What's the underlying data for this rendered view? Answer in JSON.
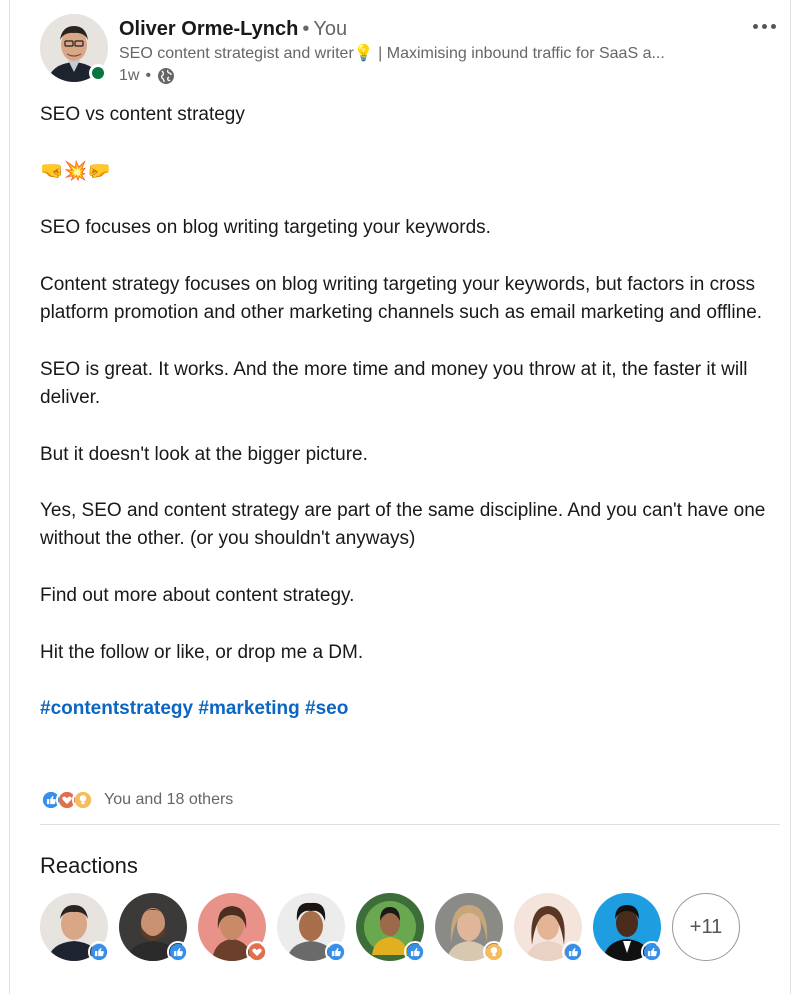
{
  "author": {
    "name": "Oliver Orme-Lynch",
    "separator": "•",
    "relation": "You",
    "headline": "SEO content strategist and writer💡 | Maximising inbound traffic for SaaS a...",
    "time": "1w",
    "meta_sep": "•",
    "visibility_icon": "globe-icon"
  },
  "post": {
    "lines": [
      "SEO vs content strategy",
      "SEO focuses on blog writing targeting your keywords.",
      "Content strategy focuses on blog writing targeting your keywords, but factors in cross platform promotion and other marketing channels such as email marketing and offline.",
      "SEO is great. It works. And the more time and money you throw at it, the faster it will deliver.",
      "But it doesn't look at the bigger picture.",
      "Yes, SEO and content strategy are part of the same discipline. And you can't have one without the other. (or you shouldn't anyways)",
      "Find out more about content strategy.",
      "Hit the follow or like, or drop me a DM."
    ],
    "emoji": "🤜💥🤛",
    "hashtags": [
      "#contentstrategy",
      "#marketing",
      "#seo"
    ]
  },
  "reactions_summary": {
    "icons": [
      "like-icon",
      "love-icon",
      "insightful-icon"
    ],
    "text": "You and 18 others"
  },
  "reactions_section": {
    "title": "Reactions",
    "reactors": [
      {
        "reaction": "like"
      },
      {
        "reaction": "like"
      },
      {
        "reaction": "love"
      },
      {
        "reaction": "like"
      },
      {
        "reaction": "like"
      },
      {
        "reaction": "insightful"
      },
      {
        "reaction": "like"
      },
      {
        "reaction": "like"
      }
    ],
    "more_label": "+11"
  },
  "colors": {
    "accent": "#0a66c2",
    "online": "#057642",
    "like": "#378fe9",
    "love": "#df704d",
    "insightful": "#f5bb5c"
  }
}
